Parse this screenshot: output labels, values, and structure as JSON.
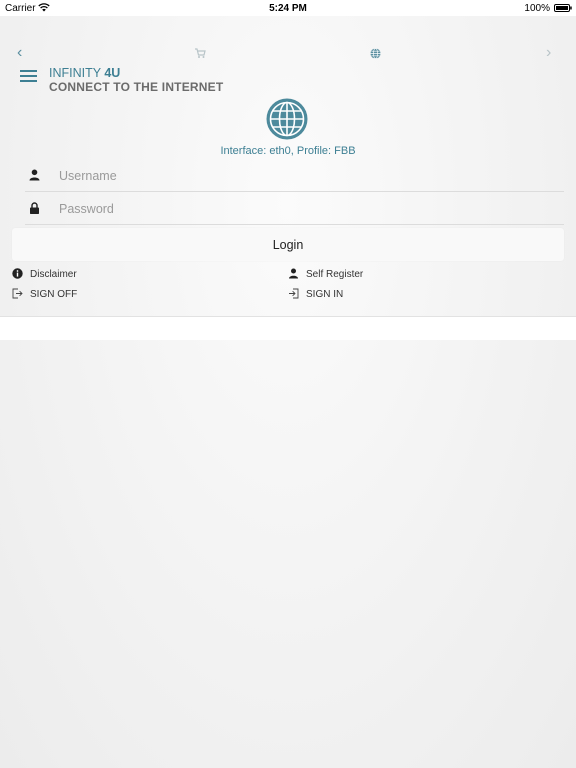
{
  "status_bar": {
    "carrier": "Carrier",
    "time": "5:24 PM",
    "battery": "100%"
  },
  "nav": {
    "back_icon": "chevron-left-icon",
    "cart_icon": "cart-icon",
    "globe_icon": "globe-icon",
    "forward_icon": "chevron-right-icon"
  },
  "header": {
    "brand_prefix": "INFINITY ",
    "brand_suffix": "4U",
    "subtitle": "CONNECT TO THE INTERNET"
  },
  "interface_info": "Interface: eth0, Profile: FBB",
  "form": {
    "username_placeholder": "Username",
    "password_placeholder": "Password",
    "login_label": "Login"
  },
  "links": {
    "disclaimer": "Disclaimer",
    "self_register": "Self Register",
    "sign_off": "SIGN OFF",
    "sign_in": "SIGN IN"
  },
  "colors": {
    "accent": "#3d7f93",
    "subtitle": "#6b6b6b"
  }
}
